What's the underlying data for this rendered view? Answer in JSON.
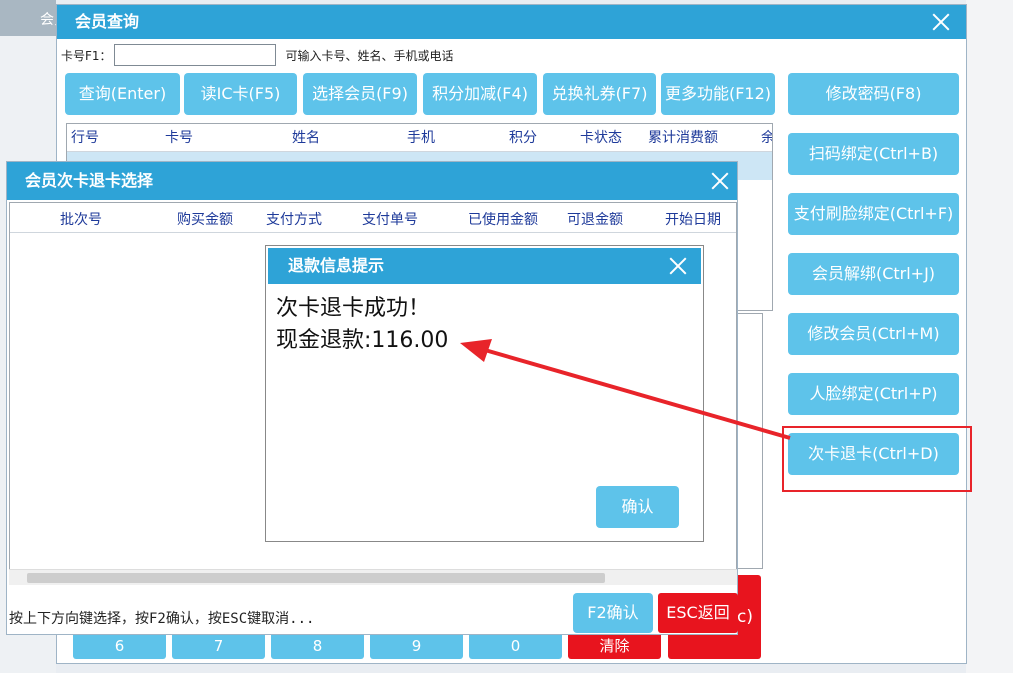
{
  "bg": {
    "tab_label": "会员管理"
  },
  "main": {
    "title": "会员查询",
    "card_label": "卡号F1：",
    "card_value": "",
    "card_hint": "可输入卡号、姓名、手机或电话",
    "toolbar": [
      "查询(Enter)",
      "读IC卡(F5)",
      "选择会员(F9)",
      "积分加减(F4)",
      "兑换礼券(F7)",
      "更多功能(F12)"
    ],
    "columns": [
      "行号",
      "卡号",
      "姓名",
      "手机",
      "积分",
      "卡状态",
      "累计消费额",
      "余"
    ],
    "side_buttons": [
      "修改密码(F8)",
      "扫码绑定(Ctrl+B)",
      "支付刷脸绑定(Ctrl+F)",
      "会员解绑(Ctrl+J)",
      "修改会员(Ctrl+M)",
      "人脸绑定(Ctrl+P)",
      "次卡退卡(Ctrl+D)"
    ],
    "numpad": [
      "6",
      "7",
      "8",
      "9",
      "0"
    ],
    "clear_label": "清除",
    "red_partial": "c)"
  },
  "sub": {
    "title": "会员次卡退卡选择",
    "columns": [
      "批次号",
      "购买金额",
      "支付方式",
      "支付单号",
      "已使用金额",
      "可退金额",
      "开始日期"
    ],
    "hint": "按上下方向键选择，按F2确认，按ESC键取消...",
    "confirm_label": "F2确认",
    "cancel_label": "ESC返回"
  },
  "alert": {
    "title": "退款信息提示",
    "line1": "次卡退卡成功！",
    "line2": "现金退款:116.00",
    "ok_label": "确认"
  },
  "colors": {
    "accent": "#2ea3d7",
    "button": "#5ec3ea",
    "danger": "#e8141e",
    "annotation": "#e8242a"
  }
}
